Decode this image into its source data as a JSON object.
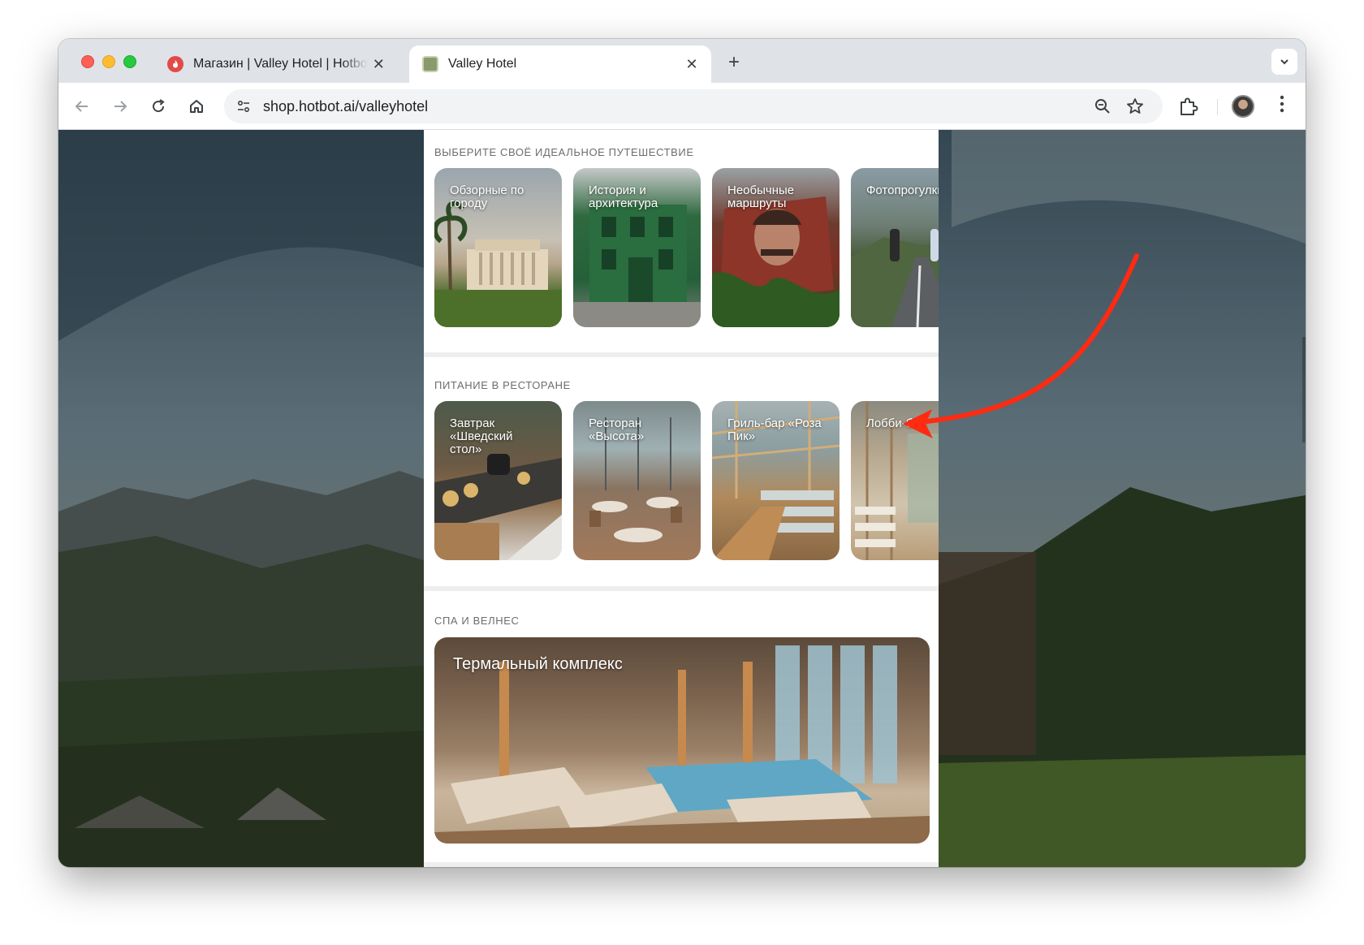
{
  "browser": {
    "tabs": [
      {
        "title": "Магазин | Valley Hotel | Hotbot",
        "active": false,
        "favicon": "hotbot-flame-icon"
      },
      {
        "title": "Valley Hotel",
        "active": true,
        "favicon": "valley-hotel-logo-icon"
      }
    ],
    "new_tab_label": "+",
    "close_label": "✕",
    "url": "shop.hotbot.ai/valleyhotel"
  },
  "page": {
    "sections": [
      {
        "label": "ВЫБЕРИТЕ СВОЁ ИДЕАЛЬНОЕ ПУТЕШЕСТВИЕ",
        "cards": [
          {
            "title": "Обзорные по\nгороду"
          },
          {
            "title": "История и\nархитектура"
          },
          {
            "title": "Необычные\nмаршруты"
          },
          {
            "title": "Фотопрогулки"
          }
        ]
      },
      {
        "label": "ПИТАНИЕ В РЕСТОРАНЕ",
        "cards": [
          {
            "title": "Завтрак\n«Шведский\nстол»"
          },
          {
            "title": "Ресторан\n«Высота»"
          },
          {
            "title": "Гриль-бар «Роза\nПик»"
          },
          {
            "title": "Лобби-бар"
          }
        ]
      },
      {
        "label": "СПА И ВЕЛНЕС",
        "cards": [
          {
            "title": "Термальный комплекс"
          }
        ]
      }
    ]
  },
  "colors": {
    "annotation_arrow": "#ff2a12",
    "tab_strip": "#dfe3e8"
  }
}
